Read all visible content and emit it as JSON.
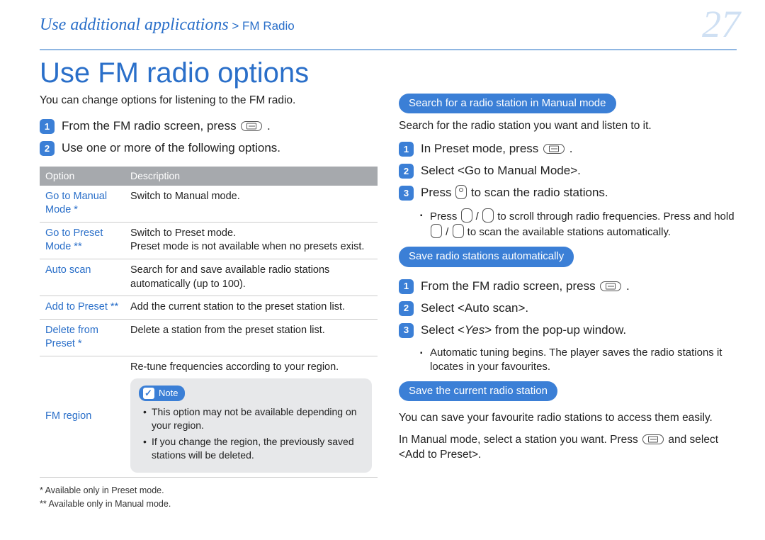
{
  "pageNumber": "27",
  "breadcrumb": {
    "main": "Use additional applications",
    "sep": " > ",
    "sub": "FM Radio"
  },
  "title": "Use FM radio options",
  "left": {
    "lead": "You can change options for listening to the FM radio.",
    "steps": [
      "From the FM radio screen, press ",
      "Use one or more of the following options."
    ],
    "tableHeaders": {
      "opt": "Option",
      "desc": "Description"
    },
    "rows": [
      {
        "opt": "Go to Manual Mode *",
        "desc": "Switch to Manual mode."
      },
      {
        "opt": "Go to Preset Mode **",
        "desc_l1": "Switch to Preset mode.",
        "desc_l2": "Preset mode is not available when no presets exist."
      },
      {
        "opt": "Auto scan",
        "desc": "Search for and save available radio stations automatically (up to 100)."
      },
      {
        "opt": "Add to Preset **",
        "desc": "Add the current station to the preset station list."
      },
      {
        "opt": "Delete from Preset *",
        "desc": "Delete a station from the preset station list."
      },
      {
        "opt": "FM region",
        "desc": "Re-tune frequencies according to your region."
      }
    ],
    "note": {
      "label": "Note",
      "items": [
        "This option may not be available depending on your region.",
        "If you change the region, the previously saved stations will be deleted."
      ]
    },
    "footnotes": [
      "* Available only in Preset mode.",
      "** Available only in Manual mode."
    ]
  },
  "right": {
    "s1": {
      "pill": "Search for a radio station in Manual mode",
      "lead": "Search for the radio station you want and listen to it.",
      "steps": {
        "a_pre": "In Preset mode, press ",
        "b": "Select <Go to Manual Mode>.",
        "c_pre": "Press ",
        "c_post": " to scan the radio stations."
      },
      "bullet_pre": "Press ",
      "bullet_mid": " / ",
      "bullet_post1": " to scroll through radio frequencies. Press and hold ",
      "bullet_post2": " to scan the available stations automatically."
    },
    "s2": {
      "pill": "Save radio stations automatically",
      "steps": {
        "a_pre": "From the FM radio screen, press ",
        "b": "Select <Auto scan>.",
        "c_pre": "Select <",
        "c_mid": "Yes",
        "c_post": "> from the pop-up window."
      },
      "bullet": "Automatic tuning begins. The player saves the radio stations it locates in your favourites."
    },
    "s3": {
      "pill": "Save the current radio station",
      "lead": "You can save your favourite radio stations to access them easily.",
      "para_pre": "In Manual mode, select a station you want. Press ",
      "para_post": " and select <Add to Preset>."
    }
  }
}
